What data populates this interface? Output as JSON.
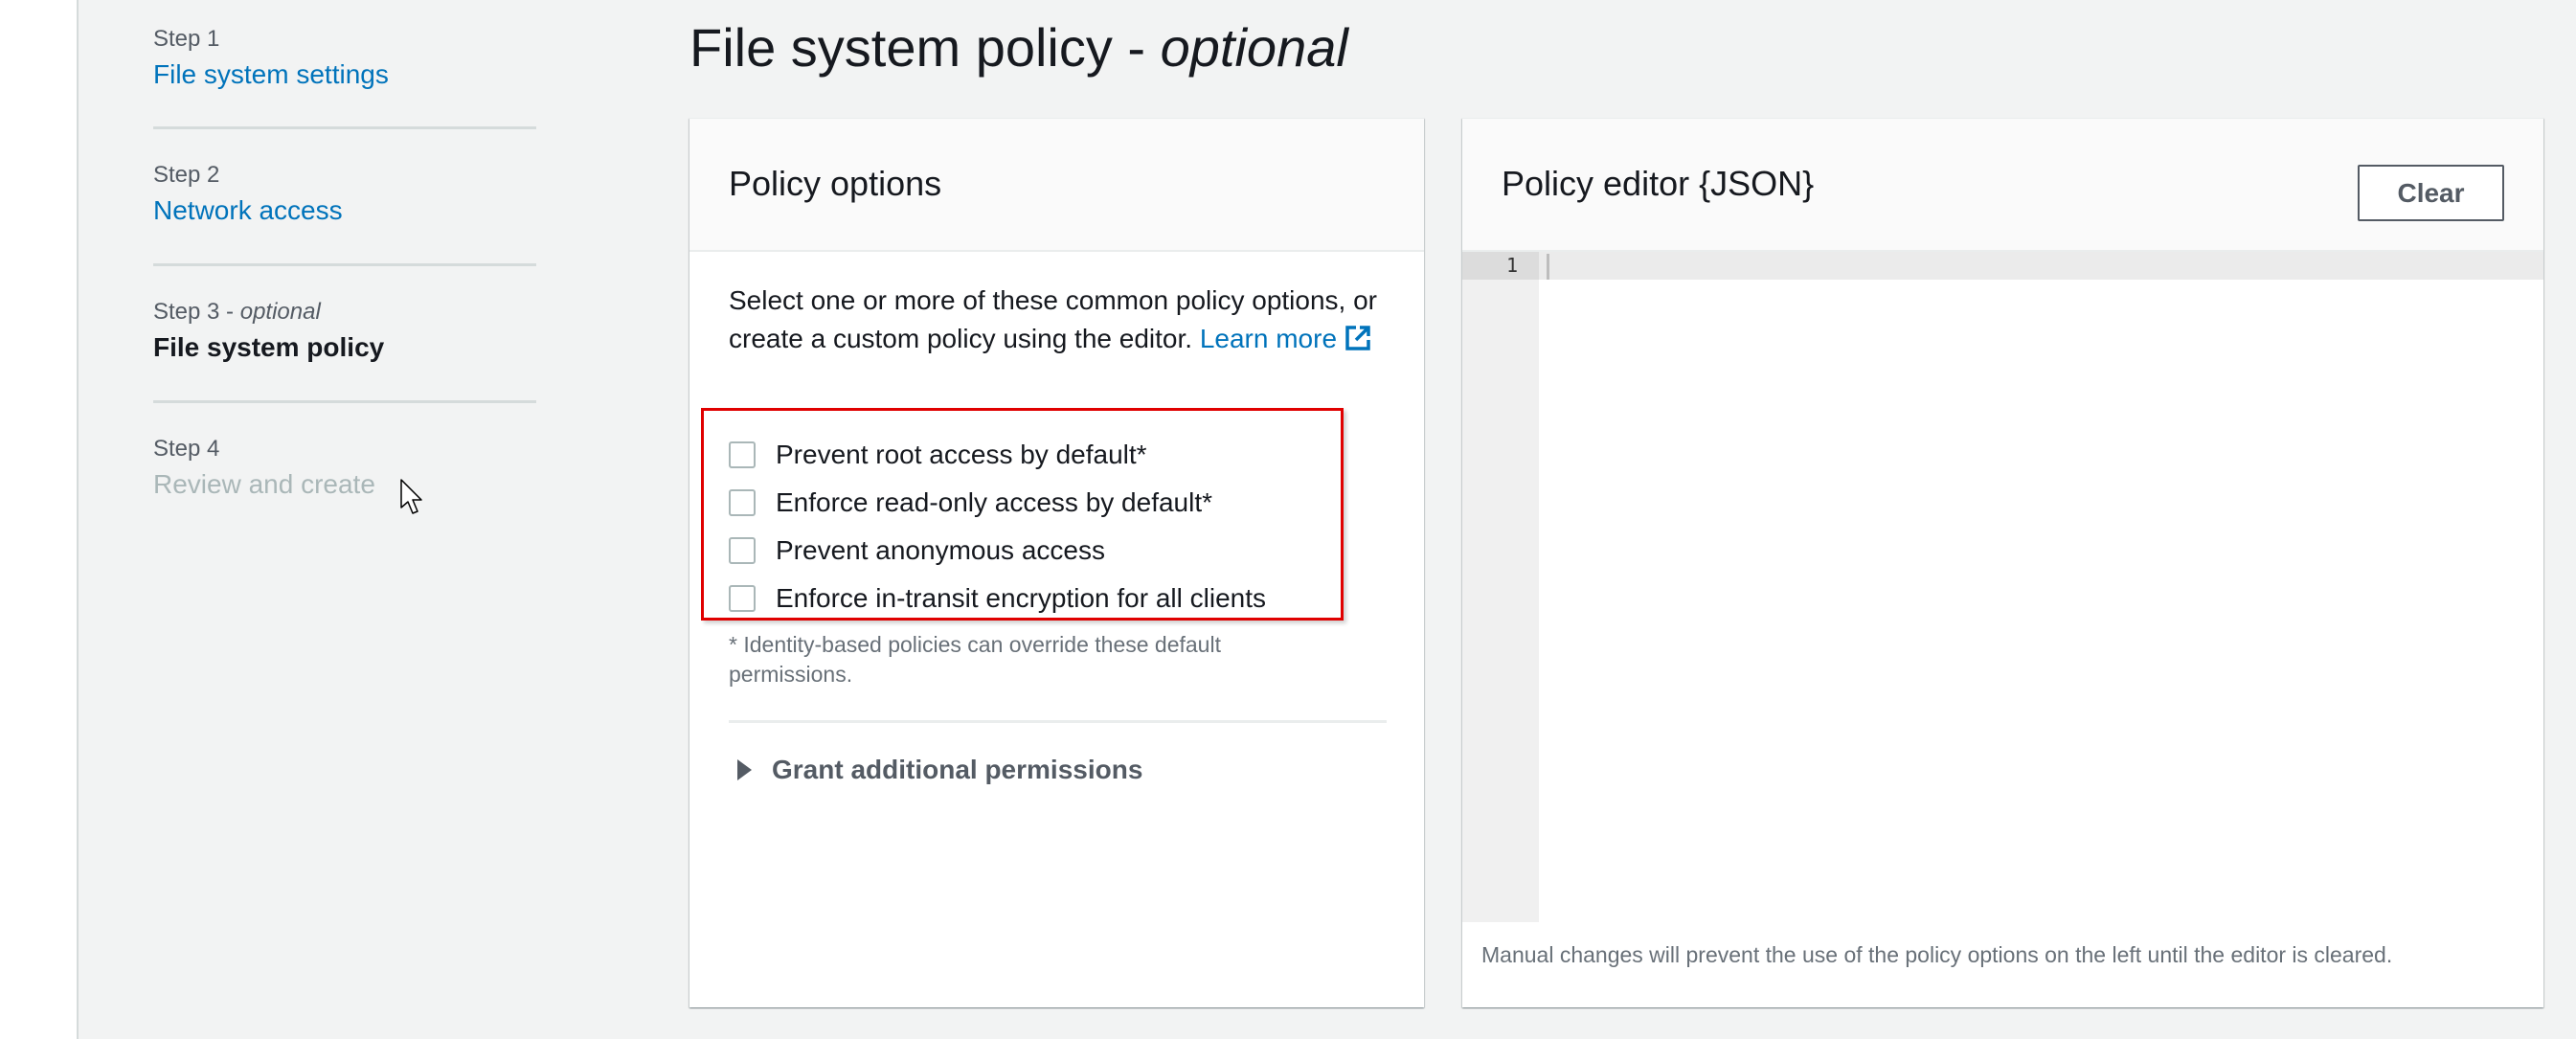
{
  "wizard": {
    "steps": [
      {
        "label": "Step 1",
        "label_suffix": "",
        "title": "File system settings",
        "state": "link"
      },
      {
        "label": "Step 2",
        "label_suffix": "",
        "title": "Network access",
        "state": "link"
      },
      {
        "label": "Step 3 - ",
        "label_suffix": "optional",
        "title": "File system policy",
        "state": "current"
      },
      {
        "label": "Step 4",
        "label_suffix": "",
        "title": "Review and create",
        "state": "disabled"
      }
    ]
  },
  "page": {
    "title": "File system policy - ",
    "title_suffix": "optional"
  },
  "policy_options": {
    "header": "Policy options",
    "description": "Select one or more of these common policy options, or create a custom policy using the editor.",
    "learn_more": "Learn more",
    "learn_more_icon": "external-link-icon",
    "options": [
      {
        "label": "Prevent root access by default*",
        "checked": false
      },
      {
        "label": "Enforce read-only access by default*",
        "checked": false
      },
      {
        "label": "Prevent anonymous access",
        "checked": false
      },
      {
        "label": "Enforce in-transit encryption for all clients",
        "checked": false
      }
    ],
    "footnote": "* Identity-based policies can override these default permissions.",
    "expandable": {
      "label": "Grant additional permissions",
      "expanded": false,
      "icon": "caret-right-icon"
    }
  },
  "policy_editor": {
    "header": "Policy editor {JSON}",
    "clear_label": "Clear",
    "line_numbers": [
      "1"
    ],
    "content": "",
    "footer": "Manual changes will prevent the use of the policy options on the left until the editor is cleared."
  },
  "colors": {
    "link": "#0073bb",
    "highlight": "#e00000",
    "background": "#f2f3f3"
  }
}
